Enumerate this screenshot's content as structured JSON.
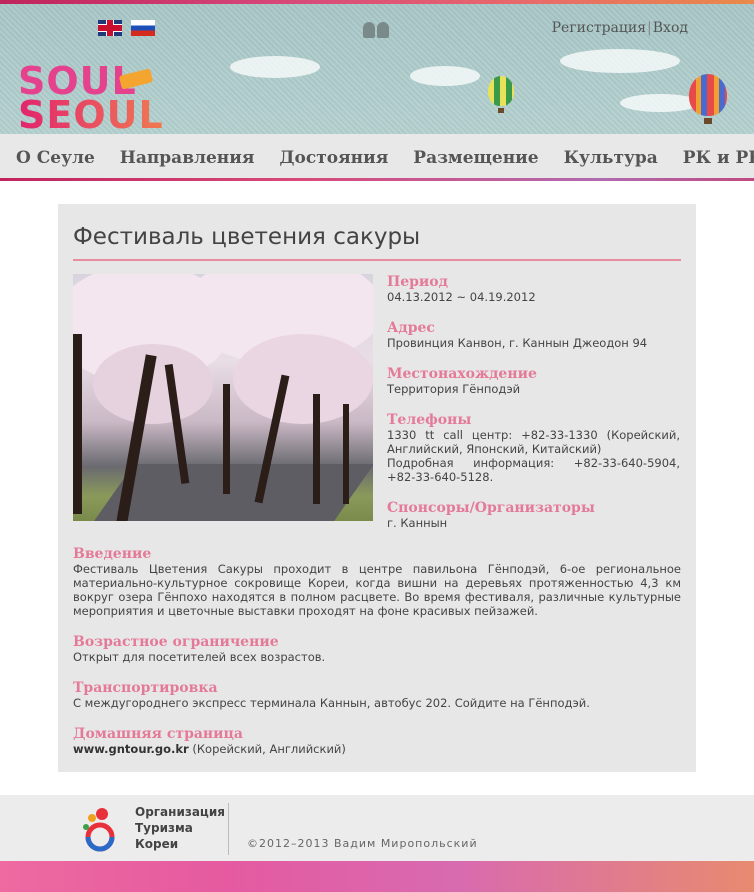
{
  "header": {
    "languages": [
      {
        "name": "english-flag",
        "icon": "uk-flag-icon"
      },
      {
        "name": "russian-flag",
        "icon": "ru-flag-icon"
      }
    ],
    "register_label": "Регистрация",
    "separator": "|",
    "login_label": "Вход",
    "logo": {
      "line1": "SOUL",
      "line2": "SEOUL"
    }
  },
  "nav": {
    "items": [
      "О Сеуле",
      "Направления",
      "Достояния",
      "Размещение",
      "Культура",
      "РК и РК"
    ]
  },
  "event": {
    "title": "Фестиваль цветения сакуры",
    "period_label": "Период",
    "period_value": "04.13.2012 ~ 04.19.2012",
    "address_label": "Адрес",
    "address_value": "Провинция Канвон, г. Каннын Джеодон 94",
    "location_label": "Местонахождение",
    "location_value": "Территория Гёнподэй",
    "phones_label": "Телефоны",
    "phones_value1": "1330 tt call центр: +82-33-1330 (Корейский, Английский, Японский, Китайский)",
    "phones_value2": "Подробная информация: +82-33-640-5904, +82-33-640-5128.",
    "sponsors_label": "Спонсоры/Организаторы",
    "sponsors_value": "г. Каннын",
    "intro_label": "Введение",
    "intro_value": "Фестиваль Цветения Сакуры проходит в центре павильона Гёнподэй, 6-ое региональное материально-культурное сокровище Кореи, когда вишни на деревьях протяженностью 4,3 км вокруг озера Гёнпохо находятся в полном расцвете. Во время фестиваля, различные культурные мероприятия и цветочные выставки проходят на фоне красивых пейзажей.",
    "age_label": "Возрастное ограничение",
    "age_value": "Открыт для посетителей всех возрастов.",
    "transport_label": "Транспортировка",
    "transport_value": "С междугороднего экспресс терминала Каннын, автобус 202. Сойдите на Гёнподэй.",
    "homepage_label": "Домашняя страница",
    "homepage_url": "www.gntour.go.kr",
    "homepage_note": " (Корейский, Английский)"
  },
  "footer": {
    "org_line1": "Организация",
    "org_line2": "Туризма",
    "org_line3": "Кореи",
    "copyright": "©2012–2013 Вадим Миропольский"
  },
  "colors": {
    "accent_pink": "#e47a98",
    "nav_text": "#555555",
    "card_bg": "#e7e7e7"
  }
}
